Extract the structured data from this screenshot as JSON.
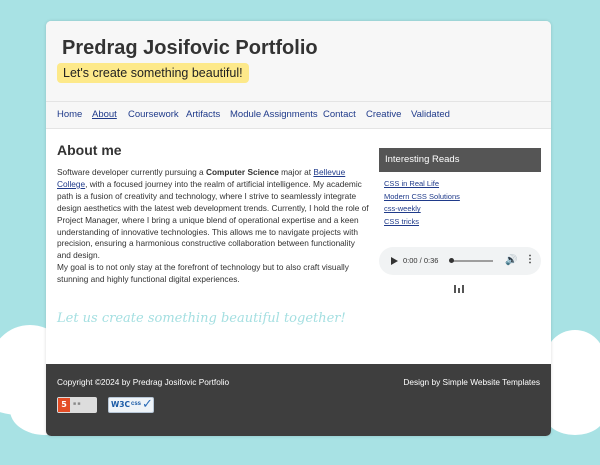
{
  "header": {
    "site_title": "Predrag Josifovic Portfolio",
    "tagline": "Let's create something beautiful!"
  },
  "nav": {
    "items": [
      {
        "label": "Home",
        "active": false
      },
      {
        "label": "About",
        "active": true
      },
      {
        "label": "Coursework",
        "active": false
      },
      {
        "label": "Artifacts",
        "active": false
      },
      {
        "label": "Module Assignments",
        "active": false
      },
      {
        "label": "Contact",
        "active": false
      },
      {
        "label": "Creative",
        "active": false
      },
      {
        "label": "Validated",
        "active": false
      }
    ]
  },
  "main": {
    "heading": "About me",
    "intro_before_bold": "Software developer currently pursuing a ",
    "bold_text": "Computer Science",
    "intro_after_bold": " major at ",
    "link_text": "Bellevue College",
    "paragraph1_rest": ", with a focused journey into the realm of artificial intelligence. My academic path is a fusion of creativity and technology, where I strive to seamlessly integrate design aesthetics with the latest web development trends. Currently, I hold the role of Project Manager, where I bring a unique blend of operational expertise and a keen understanding of innovative technologies. This allows me to navigate projects with precision, ensuring a harmonious constructive collaboration between functionality and design.",
    "paragraph2": "My goal is to not only stay at the forefront of technology but to also craft visually stunning and highly functional digital experiences.",
    "script_line": "Let us create something beautiful together!"
  },
  "sidebar": {
    "title": "Interesting Reads",
    "links": [
      "CSS in Real Life",
      "Modern CSS Solutions",
      "css-weekly",
      "CSS tricks"
    ],
    "audio": {
      "time": "0:00 / 0:36",
      "progress": 0
    }
  },
  "footer": {
    "copyright": "Copyright ©2024 by Predrag Josifovic Portfolio",
    "credit": "Design by Simple Website Templates",
    "html5_badge": "5",
    "css_badge_org": "W3C",
    "css_badge_label": "css"
  },
  "colors": {
    "background": "#a8e2e4",
    "tagline_bg": "#fde98a",
    "link": "#1f3a8a",
    "sidebar_title_bg": "#555555",
    "footer_bg": "#3e3e3e"
  }
}
